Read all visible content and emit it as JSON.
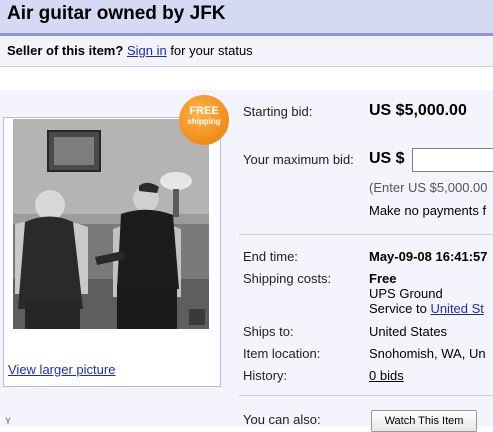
{
  "title": "Air guitar owned by JFK",
  "seller_bar": {
    "prefix": "Seller of this item?",
    "sign_in": "Sign in",
    "suffix": "for your status"
  },
  "badge": {
    "line1": "FREE",
    "line2": "shipping"
  },
  "view_larger": "View larger picture",
  "bid": {
    "starting_label": "Starting bid:",
    "starting_value": "US $5,000.00",
    "max_label": "Your maximum bid:",
    "currency": "US $",
    "enter_hint": "(Enter US $5,000.00",
    "no_payment": "Make no payments f"
  },
  "details": {
    "end_time_label": "End time:",
    "end_time_value": "May-09-08 16:41:57",
    "shipping_label": "Shipping costs:",
    "shipping_value": "Free",
    "shipping_service": "UPS Ground",
    "service_to_prefix": "Service to",
    "service_to_link": "United St",
    "ships_to_label": "Ships to:",
    "ships_to_value": "United States",
    "location_label": "Item location:",
    "location_value": "Snohomish, WA, Un",
    "history_label": "History:",
    "history_value": "0 bids"
  },
  "actions": {
    "also_label": "You can also:",
    "watch_button": "Watch This Item"
  },
  "footer_text": "Y                           "
}
